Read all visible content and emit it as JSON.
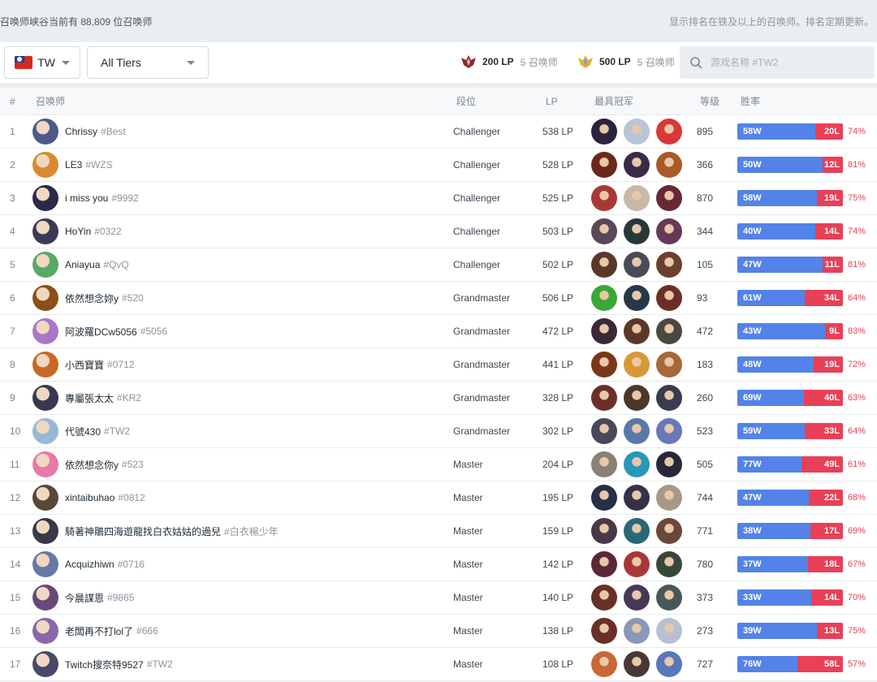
{
  "header": {
    "left_text": "召唤师峡谷当前有 88,809 位召唤师",
    "right_text": "显示排名在铁及以上的召唤师。排名定期更新。"
  },
  "filters": {
    "region": "TW",
    "tier": "All Tiers",
    "grandmaster_cutoff": {
      "lp": "200 LP",
      "count": "5 召唤师"
    },
    "challenger_cutoff": {
      "lp": "500 LP",
      "count": "5 召唤师"
    },
    "search_placeholder": "游戏名称 #TW2"
  },
  "table": {
    "headers": {
      "rank": "#",
      "summoner": "召唤师",
      "tier": "段位",
      "lp": "LP",
      "champions": "最具冠军",
      "level": "等级",
      "winrate": "胜率"
    },
    "rows": [
      {
        "rank": "1",
        "name": "Chrissy",
        "tag": "#Best",
        "tier": "Challenger",
        "lp": "538 LP",
        "level": "895",
        "wins": "58W",
        "losses": "20L",
        "pct": "74%",
        "ratio": 0.74,
        "avatar": "#4a5a8a",
        "champs": [
          "#2a2440",
          "#b8c4d8",
          "#d83838"
        ]
      },
      {
        "rank": "2",
        "name": "LE3",
        "tag": "#WZS",
        "tier": "Challenger",
        "lp": "528 LP",
        "level": "366",
        "wins": "50W",
        "losses": "12L",
        "pct": "81%",
        "ratio": 0.81,
        "avatar": "#d88a30",
        "champs": [
          "#6a2818",
          "#3a2a48",
          "#a85a28"
        ]
      },
      {
        "rank": "3",
        "name": "i miss you",
        "tag": "#9992",
        "tier": "Challenger",
        "lp": "525 LP",
        "level": "870",
        "wins": "58W",
        "losses": "19L",
        "pct": "75%",
        "ratio": 0.75,
        "avatar": "#2a2a48",
        "champs": [
          "#a83838",
          "#c8b8a8",
          "#682838"
        ]
      },
      {
        "rank": "4",
        "name": "HoYin",
        "tag": "#0322",
        "tier": "Challenger",
        "lp": "503 LP",
        "level": "344",
        "wins": "40W",
        "losses": "14L",
        "pct": "74%",
        "ratio": 0.74,
        "avatar": "#3a3a58",
        "champs": [
          "#584858",
          "#283838",
          "#683858"
        ]
      },
      {
        "rank": "5",
        "name": "Aniayua",
        "tag": "#QvQ",
        "tier": "Challenger",
        "lp": "502 LP",
        "level": "105",
        "wins": "47W",
        "losses": "11L",
        "pct": "81%",
        "ratio": 0.81,
        "avatar": "#58a868",
        "champs": [
          "#5a3828",
          "#4a4a58",
          "#6a4030"
        ]
      },
      {
        "rank": "6",
        "name": "依然想念妳y",
        "tag": "#520",
        "tier": "Grandmaster",
        "lp": "506 LP",
        "level": "93",
        "wins": "61W",
        "losses": "34L",
        "pct": "64%",
        "ratio": 0.64,
        "avatar": "#8a5018",
        "champs": [
          "#38a838",
          "#283848",
          "#6a3028"
        ]
      },
      {
        "rank": "7",
        "name": "阿波羅DCw5056",
        "tag": "#5056",
        "tier": "Grandmaster",
        "lp": "472 LP",
        "level": "472",
        "wins": "43W",
        "losses": "9L",
        "pct": "83%",
        "ratio": 0.83,
        "avatar": "#a878c8",
        "champs": [
          "#382838",
          "#5a3828",
          "#4a4840"
        ]
      },
      {
        "rank": "8",
        "name": "小西寶寶",
        "tag": "#0712",
        "tier": "Grandmaster",
        "lp": "441 LP",
        "level": "183",
        "wins": "48W",
        "losses": "19L",
        "pct": "72%",
        "ratio": 0.72,
        "avatar": "#c86828",
        "champs": [
          "#7a3818",
          "#d89838",
          "#a86838"
        ]
      },
      {
        "rank": "9",
        "name": "專屬張太太",
        "tag": "#KR2",
        "tier": "Grandmaster",
        "lp": "328 LP",
        "level": "260",
        "wins": "69W",
        "losses": "40L",
        "pct": "63%",
        "ratio": 0.63,
        "avatar": "#383850",
        "champs": [
          "#6a3028",
          "#4a3828",
          "#3a3a50"
        ]
      },
      {
        "rank": "10",
        "name": "代號430",
        "tag": "#TW2",
        "tier": "Grandmaster",
        "lp": "302 LP",
        "level": "523",
        "wins": "59W",
        "losses": "33L",
        "pct": "64%",
        "ratio": 0.64,
        "avatar": "#98b8d8",
        "champs": [
          "#484858",
          "#5878a8",
          "#6878b8"
        ]
      },
      {
        "rank": "11",
        "name": "依然想念你y",
        "tag": "#523",
        "tier": "Master",
        "lp": "204 LP",
        "level": "505",
        "wins": "77W",
        "losses": "49L",
        "pct": "61%",
        "ratio": 0.61,
        "avatar": "#e878a8",
        "champs": [
          "#8a8078",
          "#2898b8",
          "#282838"
        ]
      },
      {
        "rank": "12",
        "name": "xintaibuhao",
        "tag": "#0812",
        "tier": "Master",
        "lp": "195 LP",
        "level": "744",
        "wins": "47W",
        "losses": "22L",
        "pct": "68%",
        "ratio": 0.68,
        "avatar": "#584838",
        "champs": [
          "#283048",
          "#383048",
          "#a89888"
        ]
      },
      {
        "rank": "13",
        "name": "騎著神鵰四海遊龍找白衣姑姑的過兒",
        "tag": "#白衣楊少年",
        "tier": "Master",
        "lp": "159 LP",
        "level": "771",
        "wins": "38W",
        "losses": "17L",
        "pct": "69%",
        "ratio": 0.69,
        "avatar": "#383848",
        "champs": [
          "#483848",
          "#286878",
          "#6a4838"
        ]
      },
      {
        "rank": "14",
        "name": "Acquizhiwn",
        "tag": "#0716",
        "tier": "Master",
        "lp": "142 LP",
        "level": "780",
        "wins": "37W",
        "losses": "18L",
        "pct": "67%",
        "ratio": 0.67,
        "avatar": "#6878a8",
        "champs": [
          "#5a2838",
          "#a83838",
          "#384838"
        ]
      },
      {
        "rank": "15",
        "name": "今晨謀恩",
        "tag": "#9865",
        "tier": "Master",
        "lp": "140 LP",
        "level": "373",
        "wins": "33W",
        "losses": "14L",
        "pct": "70%",
        "ratio": 0.7,
        "avatar": "#684878",
        "champs": [
          "#6a3028",
          "#483858",
          "#485858"
        ]
      },
      {
        "rank": "16",
        "name": "老闆再不打lol了",
        "tag": "#666",
        "tier": "Master",
        "lp": "138 LP",
        "level": "273",
        "wins": "39W",
        "losses": "13L",
        "pct": "75%",
        "ratio": 0.75,
        "avatar": "#8868a8",
        "champs": [
          "#6a3028",
          "#8898b8",
          "#b8c0d0"
        ]
      },
      {
        "rank": "17",
        "name": "Twitch搜奈特9527",
        "tag": "#TW2",
        "tier": "Master",
        "lp": "108 LP",
        "level": "727",
        "wins": "76W",
        "losses": "58L",
        "pct": "57%",
        "ratio": 0.57,
        "avatar": "#484868",
        "champs": [
          "#c86838",
          "#483838",
          "#5878b8"
        ]
      }
    ]
  }
}
